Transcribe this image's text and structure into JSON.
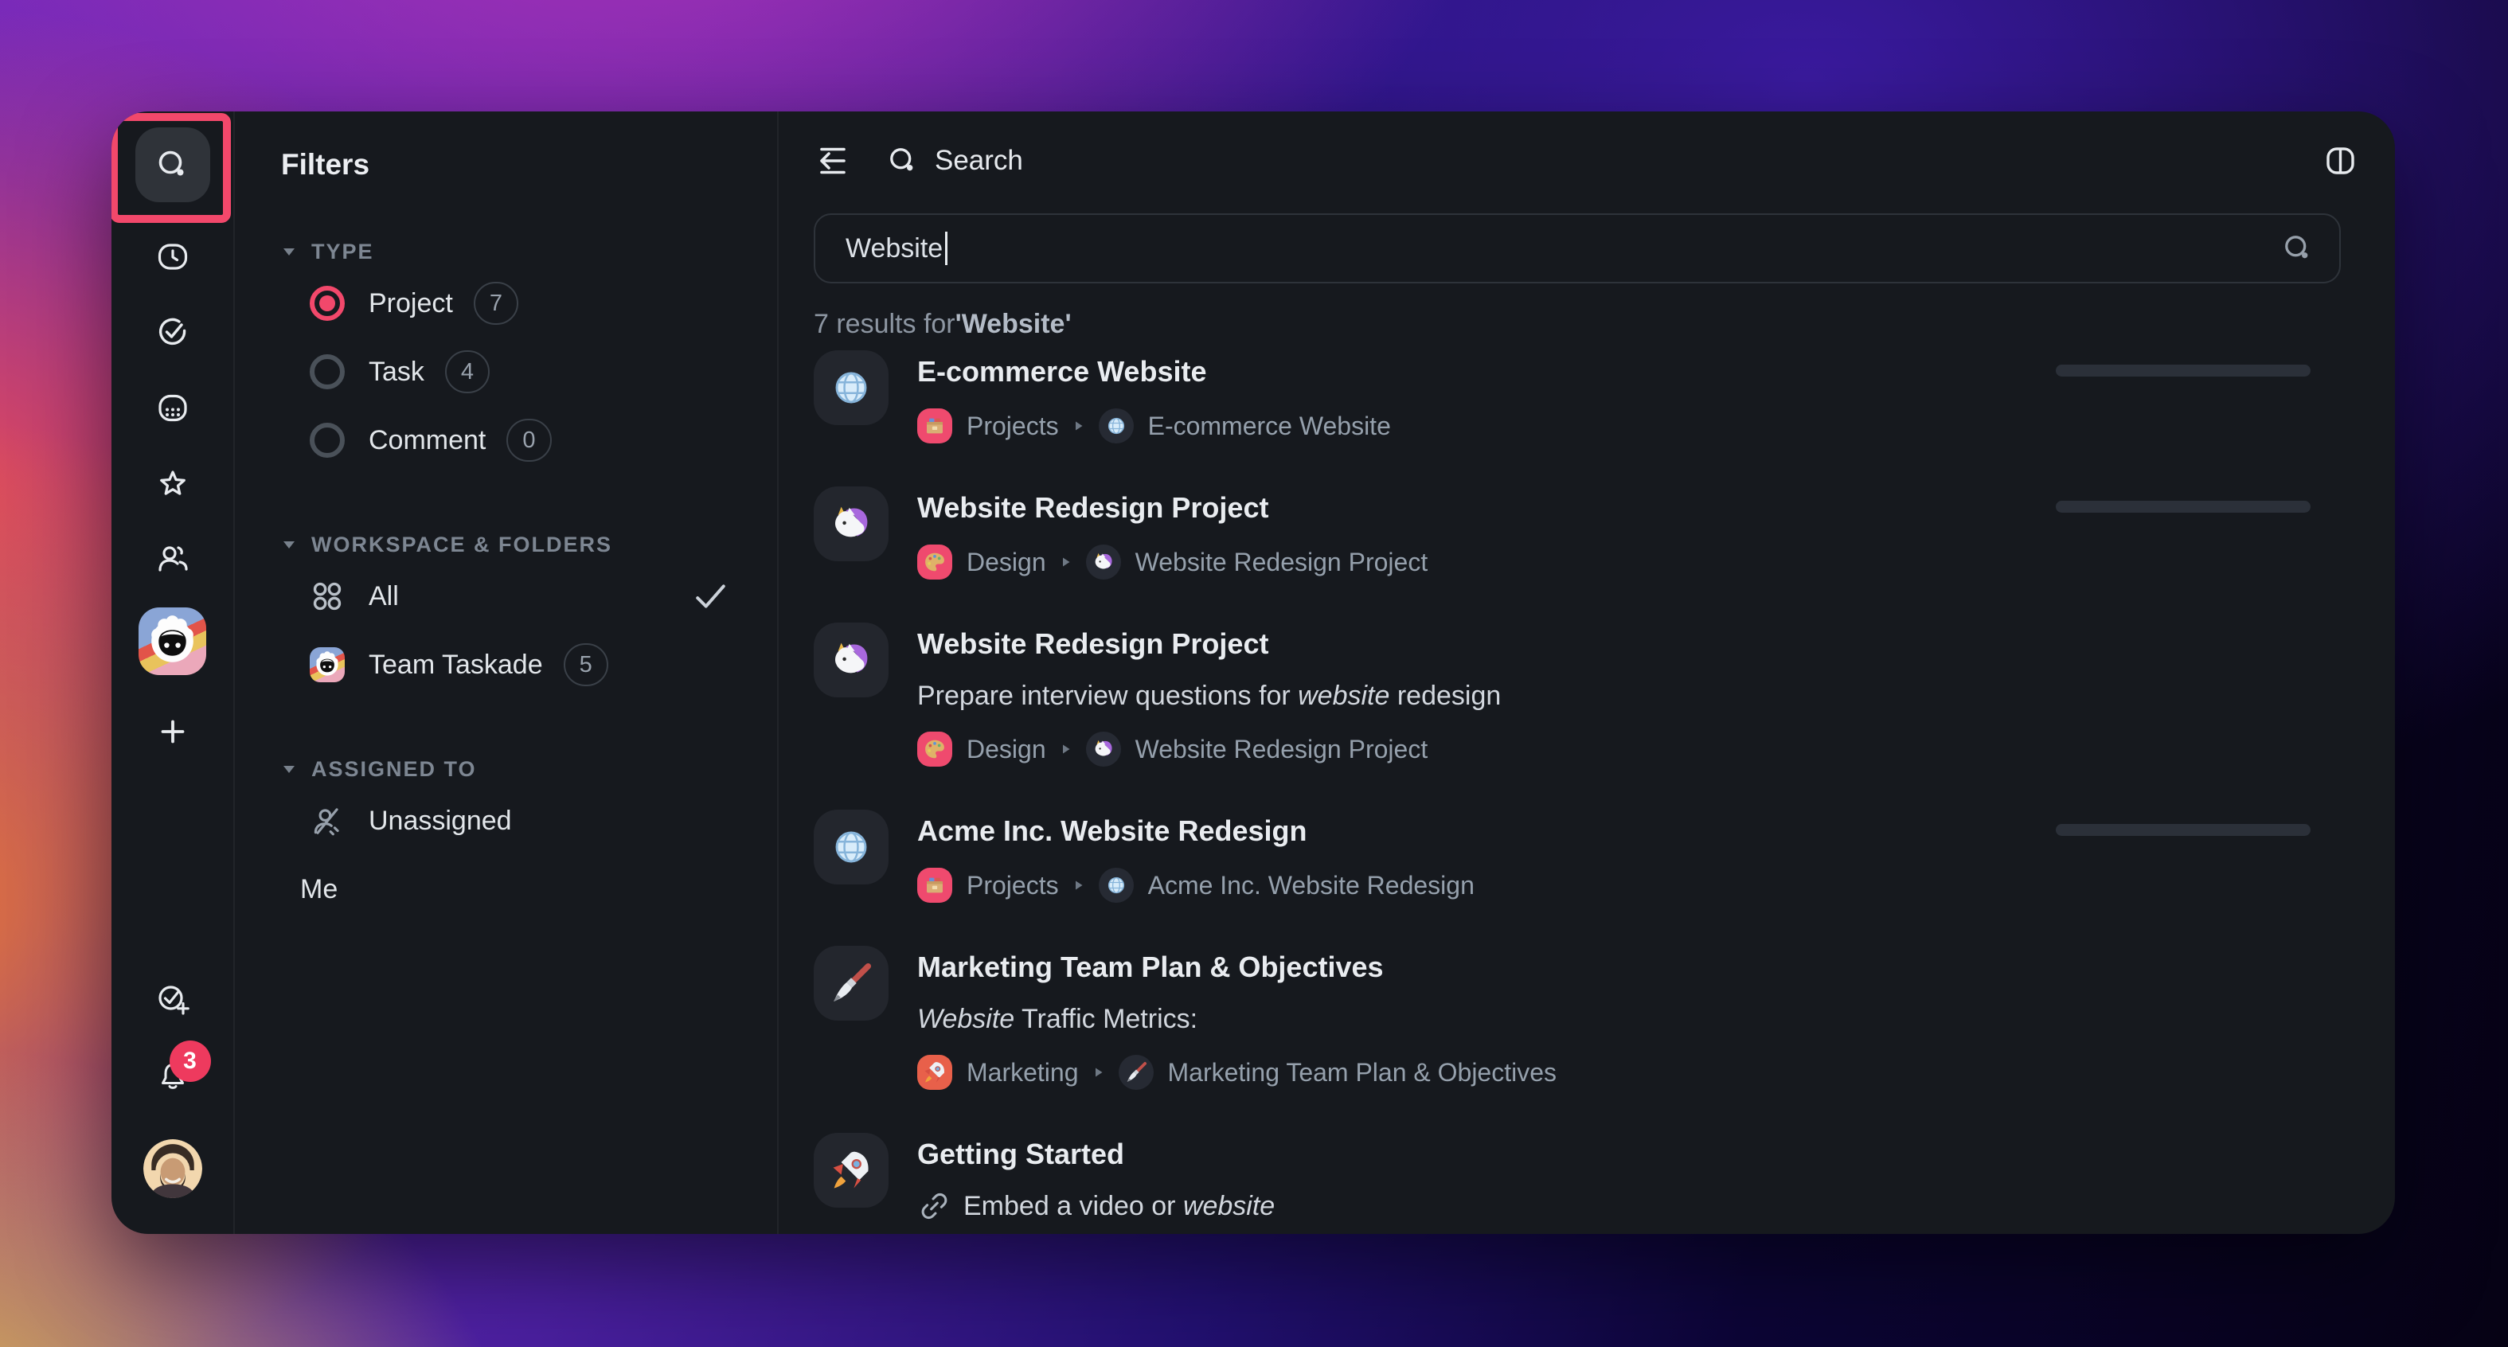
{
  "colors": {
    "accent_red": "#f2486b",
    "badge_red": "#ee3a5e",
    "window_bg": "#16191e",
    "tile_bg": "#23262d",
    "progress_bar_bg": "#2b3039",
    "folder_chip_pink": "#ef4a6e",
    "folder_chip_orange": "#e8604a"
  },
  "sidebar": {
    "icons": [
      "search-icon",
      "clock-icon",
      "my-tasks-check-icon",
      "calendar-icon",
      "star-icon",
      "contacts-icon",
      "team-avatar",
      "add-workspace-icon",
      "new-task-icon",
      "notifications-bell-icon",
      "user-avatar"
    ],
    "notification_count": "3"
  },
  "filters": {
    "title": "Filters",
    "type_section": {
      "label": "TYPE",
      "items": [
        {
          "label": "Project",
          "count": "7",
          "selected": true
        },
        {
          "label": "Task",
          "count": "4",
          "selected": false
        },
        {
          "label": "Comment",
          "count": "0",
          "selected": false
        }
      ]
    },
    "workspace_section": {
      "label": "WORKSPACE & FOLDERS",
      "items": [
        {
          "label": "All",
          "checked": true,
          "icon": "grid-circles-icon"
        },
        {
          "label": "Team Taskade",
          "count": "5",
          "icon": "team-avatar"
        }
      ]
    },
    "assigned_section": {
      "label": "ASSIGNED TO",
      "items": [
        {
          "label": "Unassigned",
          "icon": "unassigned-person-icon"
        },
        {
          "label": "Me"
        }
      ]
    }
  },
  "header": {
    "title": "Search"
  },
  "search": {
    "value": "Website"
  },
  "results": {
    "summary_prefix": "7 results for",
    "summary_query": "'Website'",
    "items": [
      {
        "title": "E-commerce Website",
        "icon": "globe-icon",
        "folder": "Projects",
        "folder_icon": "card-box-icon",
        "project": "E-commerce Website",
        "project_icon": "globe-icon",
        "has_progress": true
      },
      {
        "title": "Website Redesign Project",
        "icon": "unicorn-icon",
        "folder": "Design",
        "folder_icon": "palette-icon",
        "project": "Website Redesign Project",
        "project_icon": "unicorn-icon",
        "has_progress": true
      },
      {
        "title": "Website Redesign Project",
        "icon": "unicorn-icon",
        "snippet": {
          "pre": "Prepare interview questions for ",
          "match": "website",
          "post": " redesign"
        },
        "folder": "Design",
        "folder_icon": "palette-icon",
        "project": "Website Redesign Project",
        "project_icon": "unicorn-icon",
        "has_progress": false
      },
      {
        "title": "Acme Inc. Website Redesign",
        "icon": "globe-icon",
        "folder": "Projects",
        "folder_icon": "card-box-icon",
        "project": "Acme Inc. Website Redesign",
        "project_icon": "globe-icon",
        "has_progress": true
      },
      {
        "title": "Marketing Team Plan & Objectives",
        "icon": "paintbrush-icon",
        "snippet": {
          "pre": "",
          "match": "Website",
          "post": " Traffic Metrics:"
        },
        "folder": "Marketing",
        "folder_icon": "rocket-icon",
        "project": "Marketing Team Plan & Objectives",
        "project_icon": "paintbrush-icon",
        "has_progress": false
      },
      {
        "title": "Getting Started",
        "icon": "rocket-icon",
        "snippet": {
          "pre": "Embed a video or ",
          "match": "website",
          "post": ""
        },
        "snippet_icon": "link-icon",
        "has_progress": false
      }
    ]
  }
}
